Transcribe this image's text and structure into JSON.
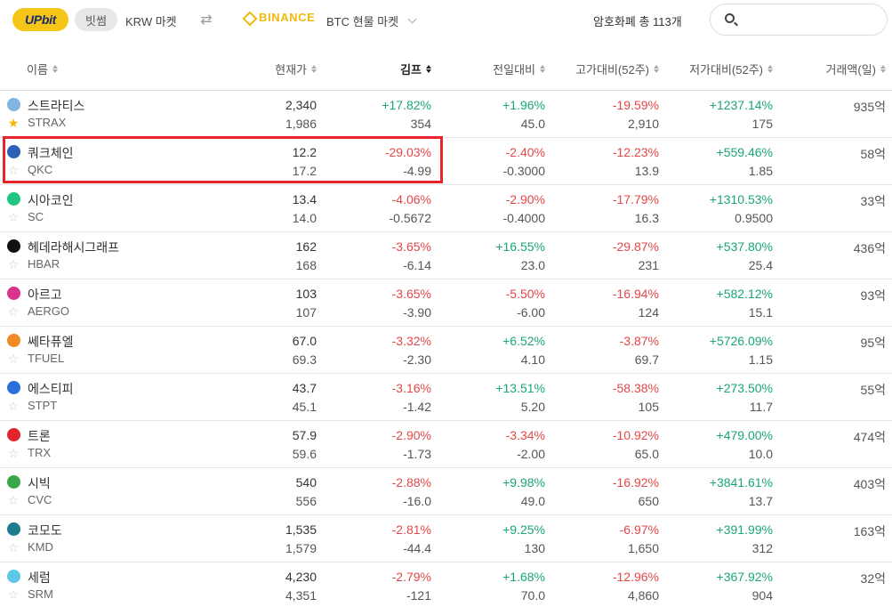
{
  "topbar": {
    "upbit_logo": "UPbit",
    "bithumb_label": "빗썸",
    "krw_market_label": "KRW 마켓",
    "swap_icon": "swap-arrows-icon",
    "binance_logo": "BINANCE",
    "btc_market_label": "BTC 현물 마켓",
    "coin_count": "암호화폐 총 113개",
    "search_placeholder": ""
  },
  "colors": {
    "up": "#1aa774",
    "down": "#e34848",
    "upbit": "#f5c518",
    "binance": "#f0b90b",
    "highlight": "#e8232a"
  },
  "header": {
    "name": "이름",
    "price": "현재가",
    "kimp": "김프",
    "day_change": "전일대비",
    "from_high": "고가대비(52주)",
    "from_low": "저가대비(52주)",
    "volume": "거래액(일)"
  },
  "rows": [
    {
      "name": "스트라티스",
      "symbol": "STRAX",
      "favorite": true,
      "icon_color": "#7fb5e0",
      "price_krw": "2,340",
      "price_ref": "1,986",
      "kimp_pct": "+17.82%",
      "kimp_diff": "354",
      "day_pct": "+1.96%",
      "day_diff": "45.0",
      "high_pct": "-19.59%",
      "high_val": "2,910",
      "low_pct": "+1237.14%",
      "low_val": "175",
      "volume": "935억"
    },
    {
      "name": "쿼크체인",
      "symbol": "QKC",
      "favorite": false,
      "icon_color": "#2c5fb8",
      "price_krw": "12.2",
      "price_ref": "17.2",
      "kimp_pct": "-29.03%",
      "kimp_diff": "-4.99",
      "day_pct": "-2.40%",
      "day_diff": "-0.3000",
      "high_pct": "-12.23%",
      "high_val": "13.9",
      "low_pct": "+559.46%",
      "low_val": "1.85",
      "volume": "58억"
    },
    {
      "name": "시아코인",
      "symbol": "SC",
      "favorite": false,
      "icon_color": "#20c584",
      "price_krw": "13.4",
      "price_ref": "14.0",
      "kimp_pct": "-4.06%",
      "kimp_diff": "-0.5672",
      "day_pct": "-2.90%",
      "day_diff": "-0.4000",
      "high_pct": "-17.79%",
      "high_val": "16.3",
      "low_pct": "+1310.53%",
      "low_val": "0.9500",
      "volume": "33억"
    },
    {
      "name": "헤데라해시그래프",
      "symbol": "HBAR",
      "favorite": false,
      "icon_color": "#111111",
      "price_krw": "162",
      "price_ref": "168",
      "kimp_pct": "-3.65%",
      "kimp_diff": "-6.14",
      "day_pct": "+16.55%",
      "day_diff": "23.0",
      "high_pct": "-29.87%",
      "high_val": "231",
      "low_pct": "+537.80%",
      "low_val": "25.4",
      "volume": "436억"
    },
    {
      "name": "아르고",
      "symbol": "AERGO",
      "favorite": false,
      "icon_color": "#d9348b",
      "price_krw": "103",
      "price_ref": "107",
      "kimp_pct": "-3.65%",
      "kimp_diff": "-3.90",
      "day_pct": "-5.50%",
      "day_diff": "-6.00",
      "high_pct": "-16.94%",
      "high_val": "124",
      "low_pct": "+582.12%",
      "low_val": "15.1",
      "volume": "93억"
    },
    {
      "name": "쎄타퓨엘",
      "symbol": "TFUEL",
      "favorite": false,
      "icon_color": "#f08a24",
      "price_krw": "67.0",
      "price_ref": "69.3",
      "kimp_pct": "-3.32%",
      "kimp_diff": "-2.30",
      "day_pct": "+6.52%",
      "day_diff": "4.10",
      "high_pct": "-3.87%",
      "high_val": "69.7",
      "low_pct": "+5726.09%",
      "low_val": "1.15",
      "volume": "95억"
    },
    {
      "name": "에스티피",
      "symbol": "STPT",
      "favorite": false,
      "icon_color": "#2a6fdb",
      "price_krw": "43.7",
      "price_ref": "45.1",
      "kimp_pct": "-3.16%",
      "kimp_diff": "-1.42",
      "day_pct": "+13.51%",
      "day_diff": "5.20",
      "high_pct": "-58.38%",
      "high_val": "105",
      "low_pct": "+273.50%",
      "low_val": "11.7",
      "volume": "55억"
    },
    {
      "name": "트론",
      "symbol": "TRX",
      "favorite": false,
      "icon_color": "#e0262c",
      "price_krw": "57.9",
      "price_ref": "59.6",
      "kimp_pct": "-2.90%",
      "kimp_diff": "-1.73",
      "day_pct": "-3.34%",
      "day_diff": "-2.00",
      "high_pct": "-10.92%",
      "high_val": "65.0",
      "low_pct": "+479.00%",
      "low_val": "10.0",
      "volume": "474억"
    },
    {
      "name": "시빅",
      "symbol": "CVC",
      "favorite": false,
      "icon_color": "#3aa648",
      "price_krw": "540",
      "price_ref": "556",
      "kimp_pct": "-2.88%",
      "kimp_diff": "-16.0",
      "day_pct": "+9.98%",
      "day_diff": "49.0",
      "high_pct": "-16.92%",
      "high_val": "650",
      "low_pct": "+3841.61%",
      "low_val": "13.7",
      "volume": "403억"
    },
    {
      "name": "코모도",
      "symbol": "KMD",
      "favorite": false,
      "icon_color": "#1a7c8c",
      "price_krw": "1,535",
      "price_ref": "1,579",
      "kimp_pct": "-2.81%",
      "kimp_diff": "-44.4",
      "day_pct": "+9.25%",
      "day_diff": "130",
      "high_pct": "-6.97%",
      "high_val": "1,650",
      "low_pct": "+391.99%",
      "low_val": "312",
      "volume": "163억"
    },
    {
      "name": "세럼",
      "symbol": "SRM",
      "favorite": false,
      "icon_color": "#5cc7e6",
      "price_krw": "4,230",
      "price_ref": "4,351",
      "kimp_pct": "-2.79%",
      "kimp_diff": "-121",
      "day_pct": "+1.68%",
      "day_diff": "70.0",
      "high_pct": "-12.96%",
      "high_val": "4,860",
      "low_pct": "+367.92%",
      "low_val": "904",
      "volume": "32억"
    }
  ]
}
